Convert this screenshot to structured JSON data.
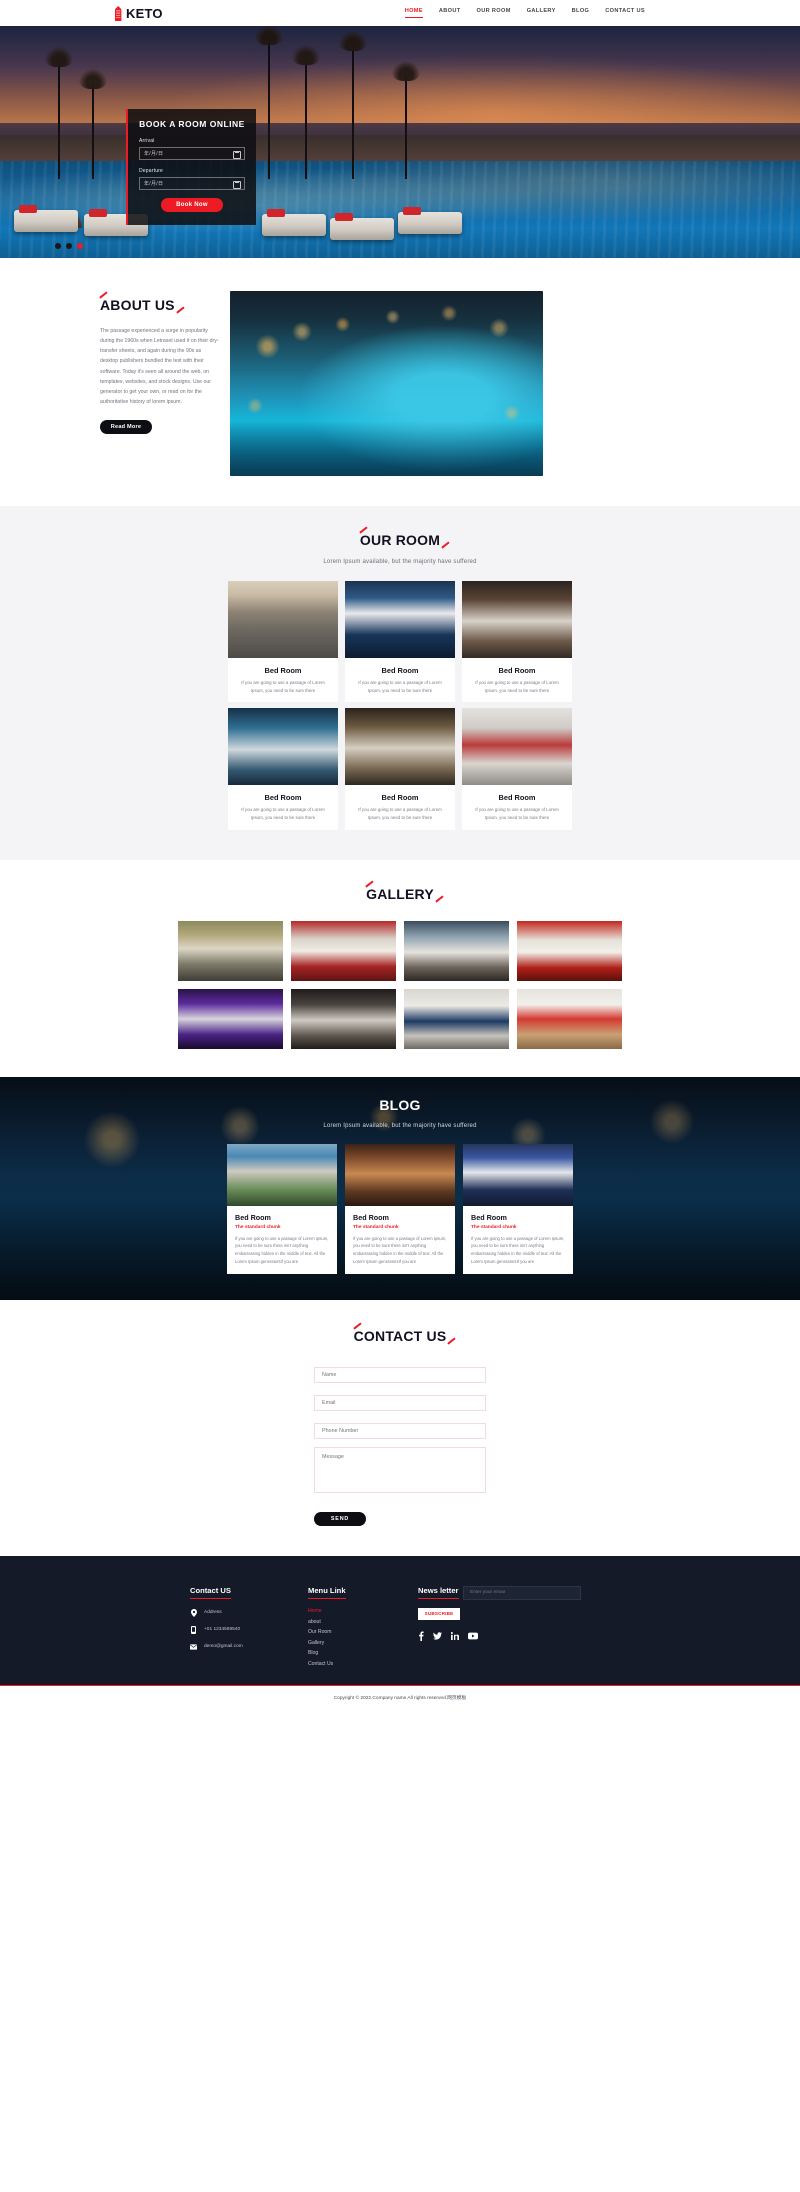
{
  "brand": {
    "icon": "building-icon",
    "name_dark": "K",
    "name_full": "KETO"
  },
  "nav": {
    "items": [
      {
        "label": "HOME",
        "active": true
      },
      {
        "label": "ABOUT",
        "active": false
      },
      {
        "label": "OUR ROOM",
        "active": false
      },
      {
        "label": "GALLERY",
        "active": false
      },
      {
        "label": "BLOG",
        "active": false
      },
      {
        "label": "CONTACT US",
        "active": false
      }
    ]
  },
  "hero": {
    "booking": {
      "title": "BOOK A ROOM ONLINE",
      "arrival_label": "Arrival",
      "arrival_value": "年/月/日",
      "departure_label": "Departure",
      "departure_value": "年/月/日",
      "button": "Book Now"
    },
    "slider_dots": [
      false,
      false,
      true
    ]
  },
  "about": {
    "title": "ABOUT US",
    "paragraph": "The passage experienced a surge in popularity during the 1960s when Letraset used it on their dry-transfer sheets, and again during the 90s as desktop publishers bundled the text with their software. Today it's seen all around the web, on templates, websites, and stock designs. Use our generator to get your own, or read on for the authoritative history of lorem ipsum.",
    "button": "Read More"
  },
  "rooms": {
    "title": "OUR ROOM",
    "subtitle": "Lorem Ipsum available, but the majority have suffered",
    "cards": [
      {
        "thumb": "t1",
        "title": "Bed Room",
        "text": "If you are going to use a passage of Lorem Ipsum, you need to be sure there"
      },
      {
        "thumb": "t2",
        "title": "Bed Room",
        "text": "If you are going to use a passage of Lorem Ipsum, you need to be sure there"
      },
      {
        "thumb": "t3",
        "title": "Bed Room",
        "text": "If you are going to use a passage of Lorem Ipsum, you need to be sure there"
      },
      {
        "thumb": "t4",
        "title": "Bed Room",
        "text": "If you are going to use a passage of Lorem Ipsum, you need to be sure there"
      },
      {
        "thumb": "t5",
        "title": "Bed Room",
        "text": "If you are going to use a passage of Lorem Ipsum, you need to be sure there"
      },
      {
        "thumb": "t6",
        "title": "Bed Room",
        "text": "If you are going to use a passage of Lorem Ipsum, you need to be sure there"
      }
    ]
  },
  "gallery": {
    "title": "GALLERY",
    "items": [
      "g1",
      "g2",
      "g3",
      "g4",
      "g5",
      "g6",
      "g7",
      "g8"
    ]
  },
  "blog": {
    "title": "BLOG",
    "subtitle": "Lorem Ipsum available, but the majority have suffered",
    "cards": [
      {
        "thumb": "b1",
        "title": "Bed Room",
        "kicker": "The standard chunk",
        "text": "If you are going to use a passage of Lorem Ipsum, you need to be sure there isn't anything embarrassing hidden in the middle of text. All the Lorem Ipsum generatorsIf you are"
      },
      {
        "thumb": "b2",
        "title": "Bed Room",
        "kicker": "The standard chunk",
        "text": "If you are going to use a passage of Lorem Ipsum, you need to be sure there isn't anything embarrassing hidden in the middle of text. All the Lorem Ipsum generatorsIf you are"
      },
      {
        "thumb": "b3",
        "title": "Bed Room",
        "kicker": "The standard chunk",
        "text": "If you are going to use a passage of Lorem Ipsum, you need to be sure there isn't anything embarrassing hidden in the middle of text. All the Lorem Ipsum generatorsIf you are"
      }
    ]
  },
  "contact": {
    "title": "CONTACT US",
    "name_placeholder": "Name",
    "email_placeholder": "Email",
    "phone_placeholder": "Phone Number",
    "message_placeholder": "Message",
    "send_label": "SEND"
  },
  "footer": {
    "contact_heading": "Contact US",
    "address": "Address",
    "phone": "+01 1234569540",
    "email": "demo@gmail.com",
    "menu_heading": "Menu Link",
    "menu": [
      {
        "label": "Home",
        "active": true
      },
      {
        "label": "about",
        "active": false
      },
      {
        "label": "Our Room",
        "active": false
      },
      {
        "label": "Gallery",
        "active": false
      },
      {
        "label": "Blog",
        "active": false
      },
      {
        "label": "Contact Us",
        "active": false
      }
    ],
    "news_heading": "News letter",
    "news_placeholder": "Enter your email",
    "subscribe_label": "SUBSCRIBE",
    "socials": [
      "facebook-icon",
      "twitter-icon",
      "linkedin-icon",
      "youtube-icon"
    ],
    "copyright": "Copyright © 2022.Company name All rights reserved.网页模板"
  },
  "colors": {
    "accent": "#ec1b24",
    "dark": "#141a28",
    "muted": "#7b7b88"
  }
}
